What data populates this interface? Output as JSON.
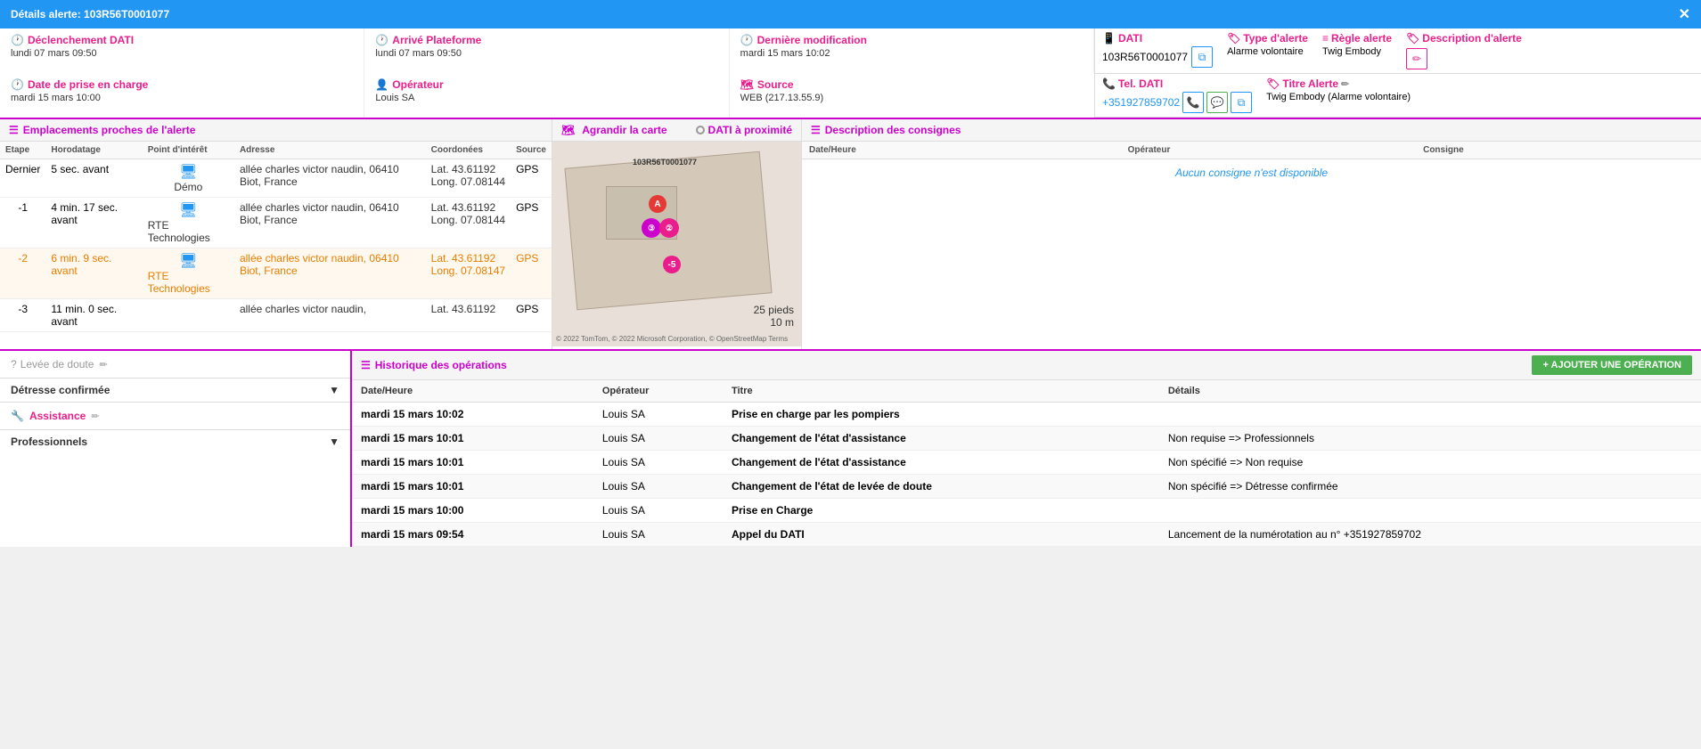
{
  "titleBar": {
    "title": "Détails alerte: 103R56T0001077",
    "closeLabel": "✕"
  },
  "header": {
    "declenchement": {
      "label": "Déclenchement DATI",
      "value": "lundi 07 mars 09:50"
    },
    "arrive": {
      "label": "Arrivé Plateforme",
      "value": "lundi 07 mars 09:50"
    },
    "derniere": {
      "label": "Dernière modification",
      "value": "mardi 15 mars 10:02"
    },
    "prise": {
      "label": "Date de prise en charge",
      "value": "mardi 15 mars 10:00"
    },
    "operateur": {
      "label": "Opérateur",
      "value": "Louis SA"
    },
    "source": {
      "label": "Source",
      "value": "WEB (217.13.55.9)"
    },
    "dati": {
      "label": "DATI",
      "value": "103R56T0001077"
    },
    "typeAlerte": {
      "label": "Type d'alerte",
      "value": "Alarme volontaire"
    },
    "regleAlerte": {
      "label": "Règle alerte",
      "value": "Twig Embody"
    },
    "descAlerte": {
      "label": "Description d'alerte"
    },
    "tel": {
      "label": "Tel. DATI",
      "value": "+351927859702"
    },
    "titreAlerte": {
      "label": "Titre Alerte",
      "value": "Twig Embody (Alarme volontaire)"
    }
  },
  "emplacements": {
    "title": "Emplacements proches de l'alerte",
    "columns": [
      "Etape",
      "Horodatage",
      "Point d'intérêt",
      "Adresse",
      "Coordonées",
      "Source"
    ],
    "rows": [
      {
        "etape": "Dernier",
        "horodatage": "5 sec. avant",
        "poi": "Démo",
        "adresse": "allée charles victor naudin, 06410 Biot, France",
        "coords": "Lat. 43.61192\nLong. 07.08144",
        "source": "GPS",
        "highlight": false
      },
      {
        "etape": "-1",
        "horodatage": "4 min. 17 sec. avant",
        "poi": "RTE Technologies",
        "adresse": "allée charles victor naudin, 06410 Biot, France",
        "coords": "Lat. 43.61192\nLong. 07.08144",
        "source": "GPS",
        "highlight": false
      },
      {
        "etape": "-2",
        "horodatage": "6 min. 9 sec. avant",
        "poi": "RTE Technologies",
        "adresse": "allée charles victor naudin, 06410 Biot, France",
        "coords": "Lat. 43.61192\nLong. 07.08147",
        "source": "GPS",
        "highlight": true
      },
      {
        "etape": "-3",
        "horodatage": "11 min. 0 sec. avant",
        "poi": "",
        "adresse": "allée charles victor naudin,",
        "coords": "Lat. 43.61192",
        "source": "GPS",
        "highlight": false
      }
    ]
  },
  "map": {
    "title": "Agrandir la carte",
    "datiLabel": "DATI à proximité",
    "deviceId": "103R56T0001077",
    "scale25ft": "25 pieds",
    "scale10m": "10 m",
    "copyright": "© 2022 TomTom, © 2022 Microsoft Corporation, © OpenStreetMap Terms"
  },
  "consignes": {
    "title": "Description des consignes",
    "columns": [
      "Date/Heure",
      "Opérateur",
      "Consigne"
    ],
    "emptyMessage": "Aucun consigne n'est disponible"
  },
  "levee": {
    "label": "Levée de doute"
  },
  "detresse": {
    "label": "Détresse confirmée"
  },
  "assistance": {
    "label": "Assistance"
  },
  "professionnels": {
    "label": "Professionnels"
  },
  "historique": {
    "title": "Historique des opérations",
    "addButtonLabel": "+ AJOUTER UNE OPÉRATION",
    "columns": [
      "Date/Heure",
      "Opérateur",
      "Titre",
      "Détails"
    ],
    "rows": [
      {
        "datetime": "mardi 15 mars 10:02",
        "operateur": "Louis SA",
        "titre": "Prise en charge par les pompiers",
        "details": ""
      },
      {
        "datetime": "mardi 15 mars 10:01",
        "operateur": "Louis SA",
        "titre": "Changement de l'état d'assistance",
        "details": "Non requise => Professionnels"
      },
      {
        "datetime": "mardi 15 mars 10:01",
        "operateur": "Louis SA",
        "titre": "Changement de l'état d'assistance",
        "details": "Non spécifié => Non requise"
      },
      {
        "datetime": "mardi 15 mars 10:01",
        "operateur": "Louis SA",
        "titre": "Changement de l'état de levée de doute",
        "details": "Non spécifié => Détresse confirmée"
      },
      {
        "datetime": "mardi 15 mars 10:00",
        "operateur": "Louis SA",
        "titre": "Prise en Charge",
        "details": ""
      },
      {
        "datetime": "mardi 15 mars 09:54",
        "operateur": "Louis SA",
        "titre": "Appel du DATI",
        "details": "Lancement de la numérotation au n° +351927859702"
      }
    ]
  }
}
